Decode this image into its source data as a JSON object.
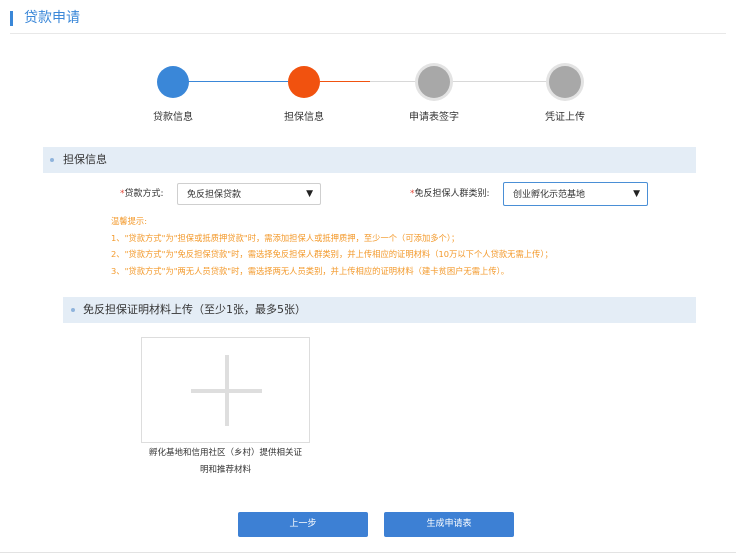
{
  "header": {
    "title": "贷款申请"
  },
  "steps": [
    {
      "label": "贷款信息",
      "state": "done",
      "color": "#3a87d8"
    },
    {
      "label": "担保信息",
      "state": "current",
      "color": "#f1520f"
    },
    {
      "label": "申请表签字",
      "state": "pending",
      "color": "#a8a8a8"
    },
    {
      "label": "凭证上传",
      "state": "pending",
      "color": "#a8a8a8"
    }
  ],
  "guarantee_section": {
    "title": "担保信息",
    "loan_method": {
      "required_mark": "*",
      "label": "贷款方式:",
      "value": "免反担保贷款"
    },
    "group_type": {
      "required_mark": "*",
      "label": "免反担保人群类别:",
      "value": "创业孵化示范基地"
    },
    "tips": [
      "温馨提示:",
      "1、\"贷款方式\"为\"担保或抵质押贷款\"时，需添加担保人或抵押质押，至少一个（可添加多个）；",
      "2、\"贷款方式\"为\"免反担保贷款\"时，需选择免反担保人群类别，并上传相应的证明材料（10万以下个人贷款无需上传）；",
      "3、\"贷款方式\"为\"两无人员贷款\"时，需选择两无人员类别，并上传相应的证明材料（建卡贫困户无需上传）。"
    ]
  },
  "upload_section": {
    "title": "免反担保证明材料上传（至少1张，最多5张）",
    "caption_line1": "孵化基地和信用社区（乡村）提供相关证",
    "caption_line2": "明和推荐材料"
  },
  "buttons": {
    "prev": "上一步",
    "generate": "生成申请表"
  },
  "colors": {
    "accent": "#3a87d8",
    "current": "#f1520f",
    "pending": "#a8a8a8",
    "tips": "#f39a2c",
    "section_bg": "#e4edf6"
  }
}
